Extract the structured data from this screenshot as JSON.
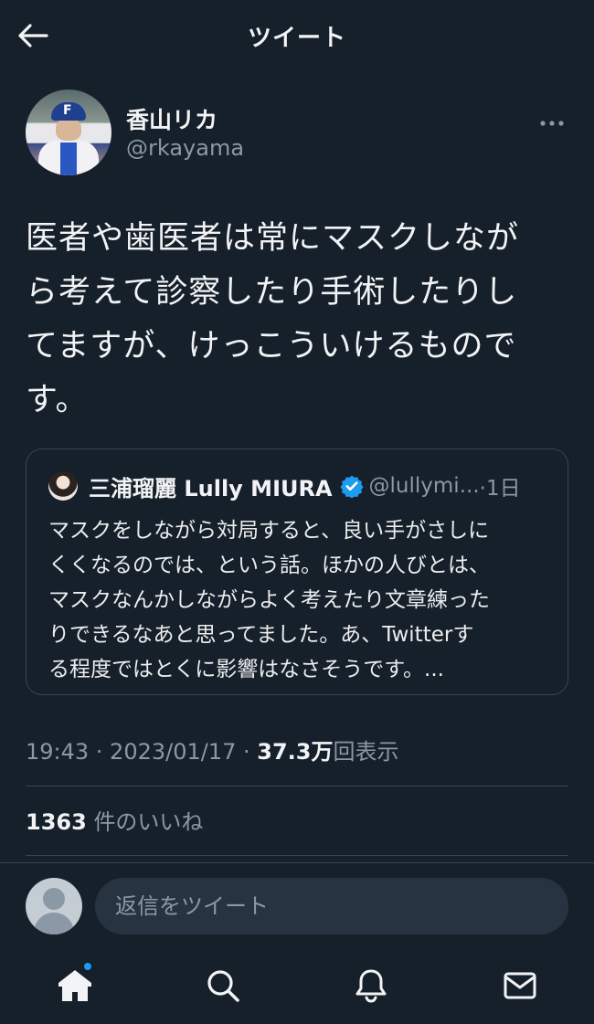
{
  "header": {
    "title": "ツイート"
  },
  "author": {
    "name": "香山リカ",
    "handle": "@rkayama"
  },
  "tweet": {
    "lines": [
      "医者や歯医者は常にマスクしなが",
      "ら考えて診察したり手術したりし",
      "てますが、けっこういけるもので",
      "す。"
    ]
  },
  "quote": {
    "name": "三浦瑠麗 Lully MIURA",
    "handle": "@lullymi...",
    "time": "·1日",
    "lines": [
      "マスクをしながら対局すると、良い手がさしに",
      "くくなるのでは、という話。ほかの人びとは、",
      "マスクなんかしながらよく考えたり文章練った",
      "りできるなあと思ってました。あ、Twitterす",
      "る程度ではとくに影響はなさそうです。..."
    ]
  },
  "meta": {
    "time": "19:43 · 2023/01/17 · ",
    "views_count": "37.3万",
    "views_label": "回表示"
  },
  "likes": {
    "count": "1363",
    "label": "件のいいね"
  },
  "reply": {
    "placeholder": "返信をツイート"
  },
  "tabs": [
    "home-icon",
    "search-icon",
    "bell-icon",
    "mail-icon"
  ],
  "colors": {
    "background": "#15202b",
    "accent": "#1d9bf0",
    "muted": "#8b98a5",
    "border": "#38444d"
  }
}
